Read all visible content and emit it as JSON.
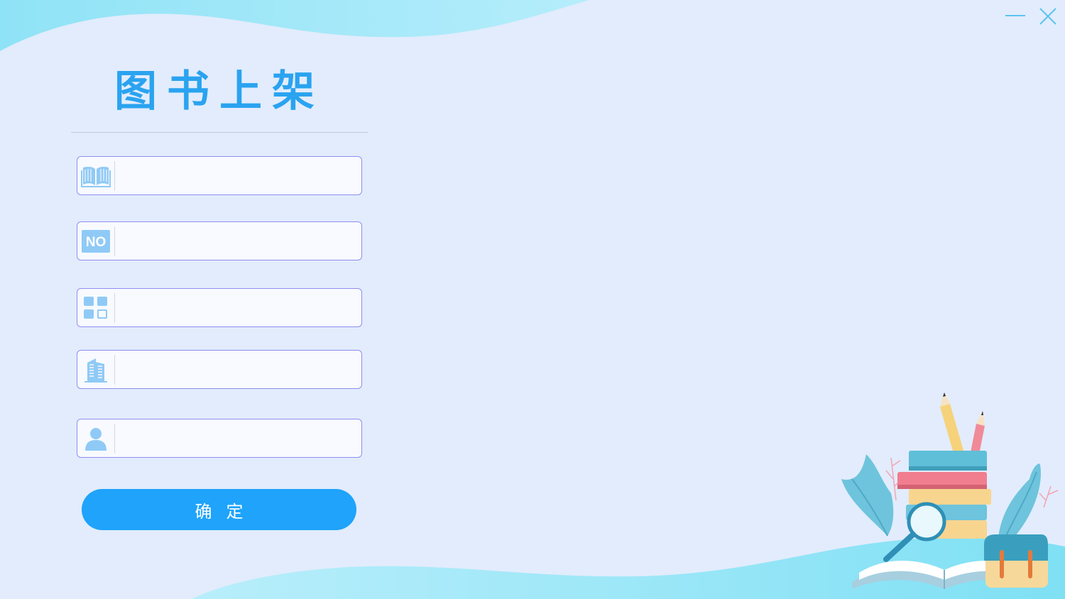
{
  "window": {
    "minimize_icon": "minimize-icon",
    "close_icon": "close-icon"
  },
  "title": "图书上架",
  "form": {
    "fields": [
      {
        "icon": "book-icon",
        "value": "",
        "placeholder": ""
      },
      {
        "icon": "no-number-icon",
        "icon_text": "NO",
        "value": "",
        "placeholder": ""
      },
      {
        "icon": "category-grid-icon",
        "value": "",
        "placeholder": ""
      },
      {
        "icon": "building-icon",
        "value": "",
        "placeholder": ""
      },
      {
        "icon": "user-icon",
        "value": "",
        "placeholder": ""
      }
    ],
    "submit_label": "确定"
  },
  "colors": {
    "accent": "#1fa3fb",
    "title": "#2aa3f0",
    "field_border": "#8f8ef0",
    "icon": "#8fcaf6",
    "background": "#e2ecfc",
    "wave": "#8fe2f6"
  }
}
